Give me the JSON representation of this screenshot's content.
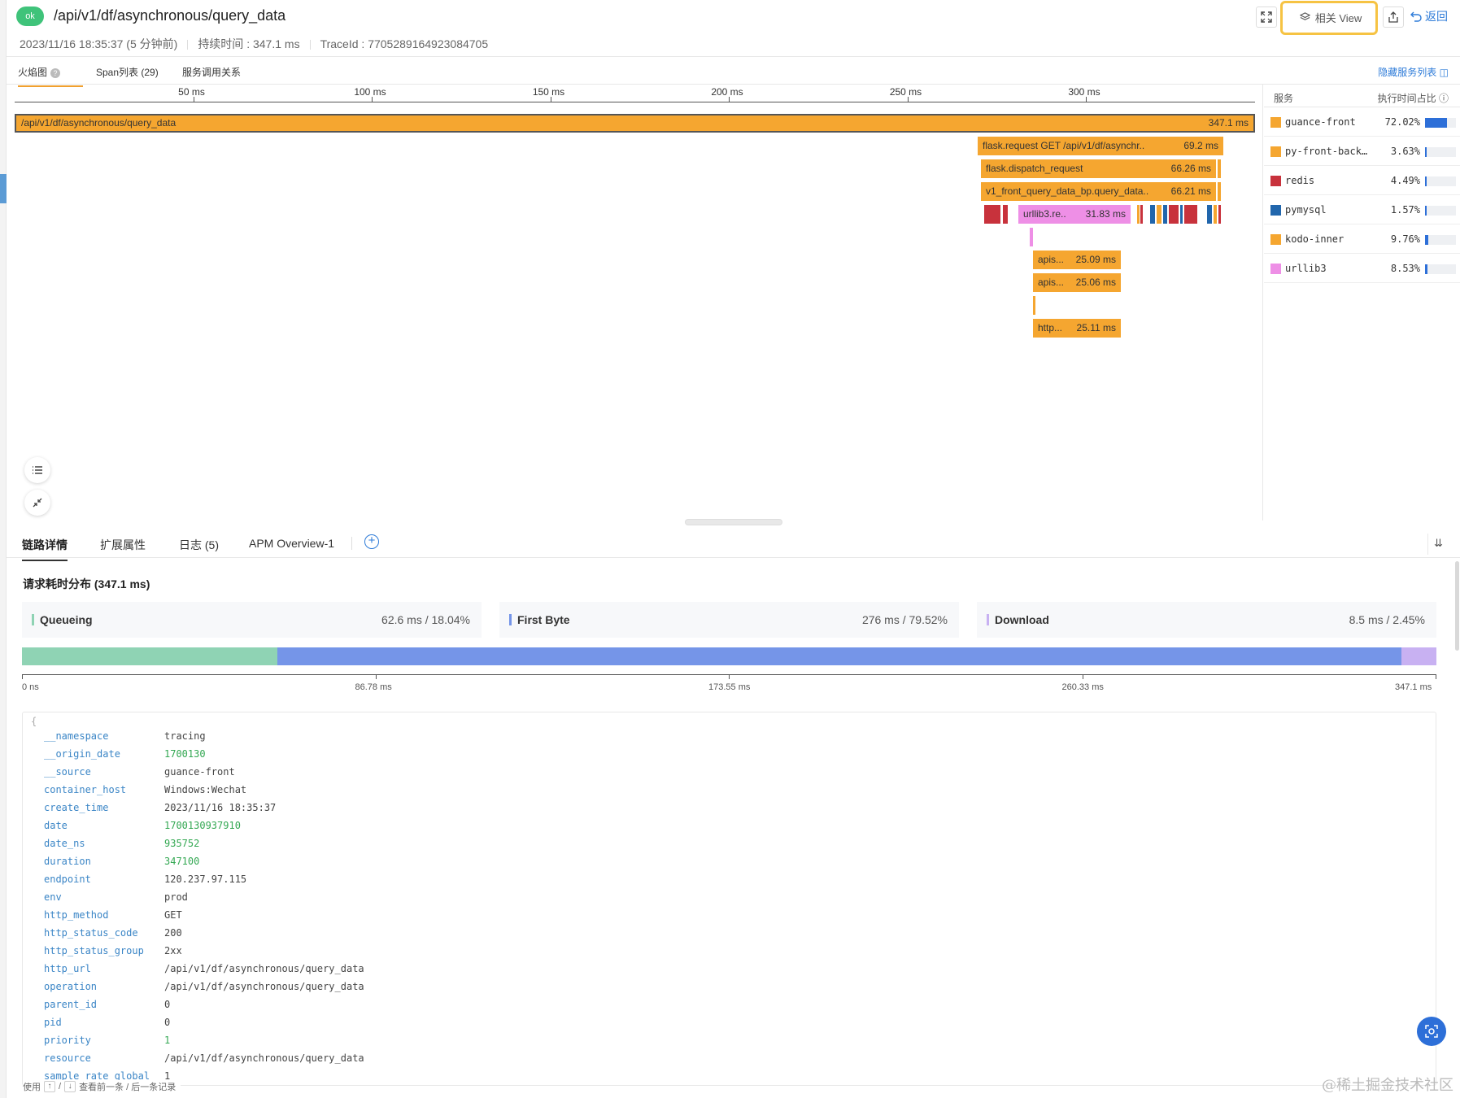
{
  "header": {
    "status": "ok",
    "title": "/api/v1/df/asynchronous/query_data",
    "start_time": "2023/11/16 18:35:37 (5 分钟前)",
    "duration": "持续时间 : 347.1 ms",
    "trace_id": "TraceId : 7705289164923084705",
    "related_view_label": "相关 View",
    "back_label": "返回"
  },
  "top_tabs": {
    "flame": "火焰图",
    "span_list": "Span列表 (29)",
    "service_map": "服务调用关系",
    "hide_services": "隐藏服务列表"
  },
  "time_axis": [
    {
      "label": "50 ms",
      "ms": 50
    },
    {
      "label": "100 ms",
      "ms": 100
    },
    {
      "label": "150 ms",
      "ms": 150
    },
    {
      "label": "200 ms",
      "ms": 200
    },
    {
      "label": "250 ms",
      "ms": 250
    },
    {
      "label": "300 ms",
      "ms": 300
    }
  ],
  "flame": {
    "root": {
      "label": "/api/v1/df/asynchronous/query_data",
      "duration": "347.1 ms"
    },
    "spans": [
      {
        "label": "flask.request GET /api/v1/df/asynchr..",
        "duration": "69.2 ms"
      },
      {
        "label": "flask.dispatch_request",
        "duration": "66.26 ms"
      },
      {
        "label": "v1_front_query_data_bp.query_data..",
        "duration": "66.21 ms"
      },
      {
        "label": "urllib3.re..",
        "duration": "31.83 ms"
      },
      {
        "label": "apis...",
        "duration": "25.09 ms"
      },
      {
        "label": "apis...",
        "duration": "25.06 ms"
      },
      {
        "label": "http...",
        "duration": "25.11 ms"
      }
    ]
  },
  "services": {
    "header_service": "服务",
    "header_ratio": "执行时间占比",
    "items": [
      {
        "name": "guance-front",
        "pct": "72.02%",
        "ratio": 0.7202,
        "color": "#f5a630"
      },
      {
        "name": "py-front-back…",
        "pct": "3.63%",
        "ratio": 0.0363,
        "color": "#f5a630"
      },
      {
        "name": "redis",
        "pct": "4.49%",
        "ratio": 0.0449,
        "color": "#c8323c"
      },
      {
        "name": "pymysql",
        "pct": "1.57%",
        "ratio": 0.0157,
        "color": "#2166ac"
      },
      {
        "name": "kodo-inner",
        "pct": "9.76%",
        "ratio": 0.0976,
        "color": "#f5a630"
      },
      {
        "name": "urllib3",
        "pct": "8.53%",
        "ratio": 0.0853,
        "color": "#ee8fe6"
      }
    ]
  },
  "bottom_tabs": {
    "trace_detail": "链路详情",
    "extended": "扩展属性",
    "logs": "日志 (5)",
    "apm": "APM Overview-1"
  },
  "distribution": {
    "title": "请求耗时分布 (347.1 ms)",
    "phases": [
      {
        "name": "Queueing",
        "value": "62.6 ms  /  18.04%",
        "color": "#8fd3b4",
        "fraction": 0.1804
      },
      {
        "name": "First Byte",
        "value": "276 ms  /  79.52%",
        "color": "#7595e8",
        "fraction": 0.7952
      },
      {
        "name": "Download",
        "value": "8.5 ms  /  2.45%",
        "color": "#c8b1f2",
        "fraction": 0.0245
      }
    ],
    "axis": [
      "0 ns",
      "86.78 ms",
      "173.55 ms",
      "260.33 ms",
      "347.1 ms"
    ]
  },
  "json": {
    "open_brace": "{",
    "rows": [
      {
        "key": "__namespace",
        "value": "tracing",
        "num": false
      },
      {
        "key": "__origin_date",
        "value": "1700130",
        "num": true
      },
      {
        "key": "__source",
        "value": "guance-front",
        "num": false
      },
      {
        "key": "container_host",
        "value": "Windows:Wechat",
        "num": false
      },
      {
        "key": "create_time",
        "value": "2023/11/16 18:35:37",
        "num": false
      },
      {
        "key": "date",
        "value": "1700130937910",
        "num": true
      },
      {
        "key": "date_ns",
        "value": "935752",
        "num": true
      },
      {
        "key": "duration",
        "value": "347100",
        "num": true
      },
      {
        "key": "endpoint",
        "value": "120.237.97.115",
        "num": false
      },
      {
        "key": "env",
        "value": "prod",
        "num": false
      },
      {
        "key": "http_method",
        "value": "GET",
        "num": false
      },
      {
        "key": "http_status_code",
        "value": "200",
        "num": false
      },
      {
        "key": "http_status_group",
        "value": "2xx",
        "num": false
      },
      {
        "key": "http_url",
        "value": "/api/v1/df/asynchronous/query_data",
        "num": false
      },
      {
        "key": "operation",
        "value": "/api/v1/df/asynchronous/query_data",
        "num": false
      },
      {
        "key": "parent_id",
        "value": "0",
        "num": false
      },
      {
        "key": "pid",
        "value": "0",
        "num": false
      },
      {
        "key": "priority",
        "value": "1",
        "num": true
      },
      {
        "key": "resource",
        "value": "/api/v1/df/asynchronous/query_data",
        "num": false
      },
      {
        "key": "sample_rate_global",
        "value": "1",
        "num": false
      }
    ]
  },
  "footer": {
    "use": "使用",
    "up": "↑",
    "slash": "/",
    "down": "↓",
    "hint": "查看前一条 / 后一条记录",
    "watermark": "@稀土掘金技术社区"
  }
}
